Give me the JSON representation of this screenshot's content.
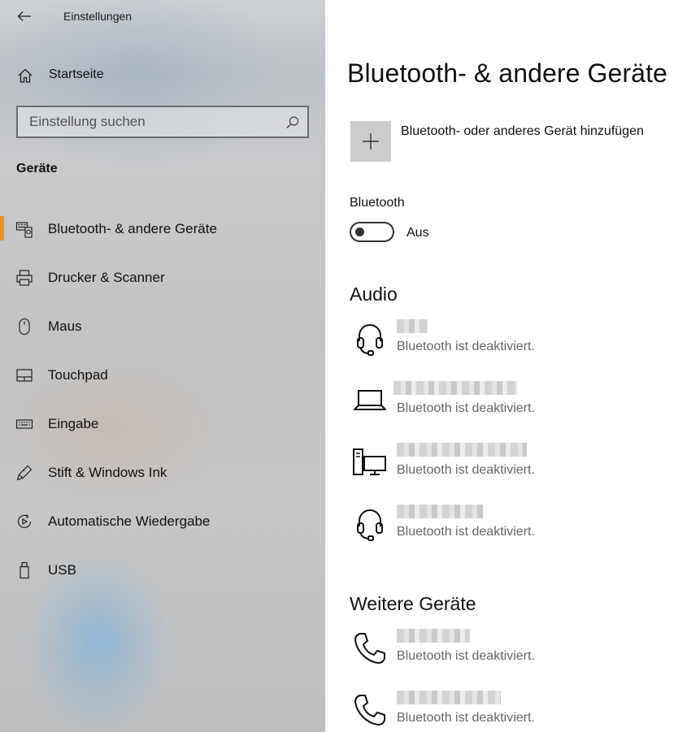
{
  "app": {
    "title": "Einstellungen"
  },
  "sidebar": {
    "home_label": "Startseite",
    "search_placeholder": "Einstellung suchen",
    "section_title": "Geräte",
    "items": [
      {
        "label": "Bluetooth- & andere Geräte",
        "icon": "bluetooth-devices-icon",
        "active": true
      },
      {
        "label": "Drucker & Scanner",
        "icon": "printer-icon",
        "active": false
      },
      {
        "label": "Maus",
        "icon": "mouse-icon",
        "active": false
      },
      {
        "label": "Touchpad",
        "icon": "touchpad-icon",
        "active": false
      },
      {
        "label": "Eingabe",
        "icon": "keyboard-icon",
        "active": false
      },
      {
        "label": "Stift & Windows Ink",
        "icon": "pen-icon",
        "active": false
      },
      {
        "label": "Automatische Wiedergabe",
        "icon": "autoplay-icon",
        "active": false
      },
      {
        "label": "USB",
        "icon": "usb-icon",
        "active": false
      }
    ]
  },
  "main": {
    "title": "Bluetooth- & andere Geräte",
    "add_device_label": "Bluetooth- oder anderes Gerät hinzufügen",
    "bluetooth": {
      "label": "Bluetooth",
      "state_label": "Aus",
      "on": false
    },
    "audio": {
      "title": "Audio",
      "devices": [
        {
          "icon": "headset-icon",
          "status": "Bluetooth ist deaktiviert."
        },
        {
          "icon": "laptop-icon",
          "status": "Bluetooth ist deaktiviert."
        },
        {
          "icon": "desktop-computer-icon",
          "status": "Bluetooth ist deaktiviert."
        },
        {
          "icon": "headset-icon",
          "status": "Bluetooth ist deaktiviert."
        }
      ]
    },
    "other": {
      "title": "Weitere Geräte",
      "devices": [
        {
          "icon": "phone-icon",
          "status": "Bluetooth ist deaktiviert."
        },
        {
          "icon": "phone-icon",
          "status": "Bluetooth ist deaktiviert."
        }
      ]
    }
  },
  "colors": {
    "accent": "#e8922a",
    "plus_tile": "#cccccc",
    "status_text": "#666666"
  }
}
